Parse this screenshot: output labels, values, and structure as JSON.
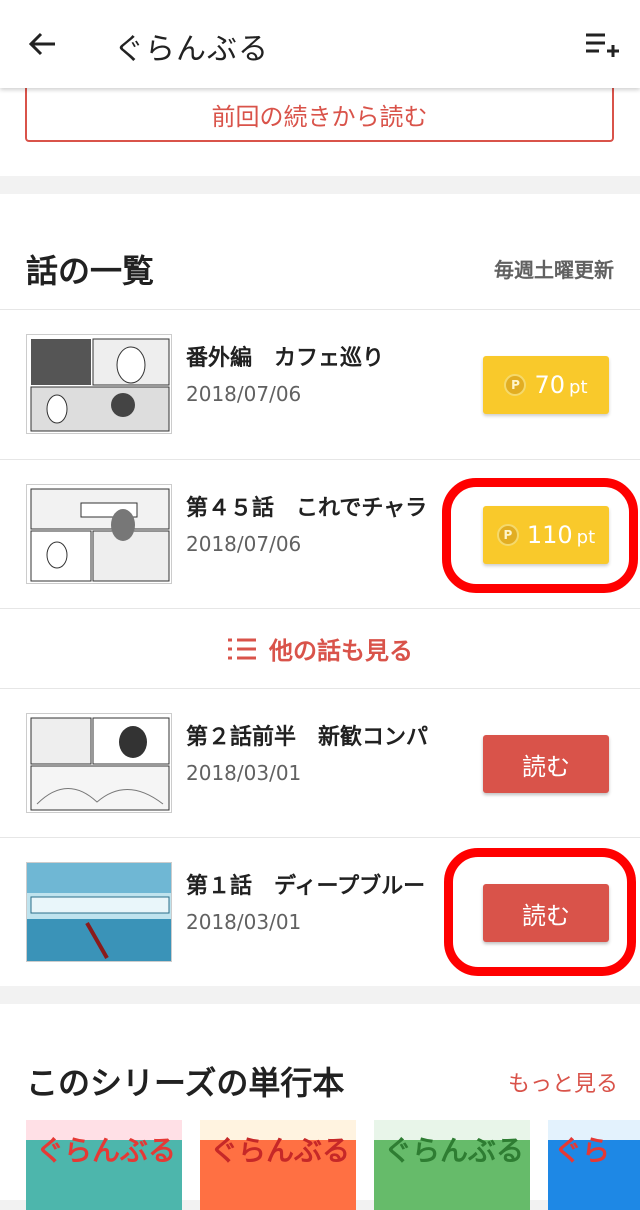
{
  "app_bar": {
    "title": "ぐらんぶる"
  },
  "continue_button": {
    "label": "前回の続きから読む"
  },
  "episodes_section": {
    "title": "話の一覧",
    "update_schedule": "毎週土曜更新",
    "more_label": "他の話も見る",
    "coin_symbol": "P",
    "pt_unit": "pt",
    "read_label": "読む",
    "episodes": [
      {
        "title": "番外編　カフェ巡り",
        "date": "2018/07/06",
        "price": "70"
      },
      {
        "title": "第４５話　これでチャラ",
        "date": "2018/07/06",
        "price": "110"
      },
      {
        "title": "第２話前半　新歓コンパ",
        "date": "2018/03/01"
      },
      {
        "title": "第１話　ディープブルー",
        "date": "2018/03/01"
      }
    ]
  },
  "volumes_section": {
    "title": "このシリーズの単行本",
    "more_label": "もっと見る",
    "covers": [
      "volume-11",
      "volume-10",
      "volume-9",
      "volume-8"
    ]
  },
  "colors": {
    "accent": "#d9534a",
    "points": "#f9c92b",
    "highlight": "#ff0000"
  }
}
